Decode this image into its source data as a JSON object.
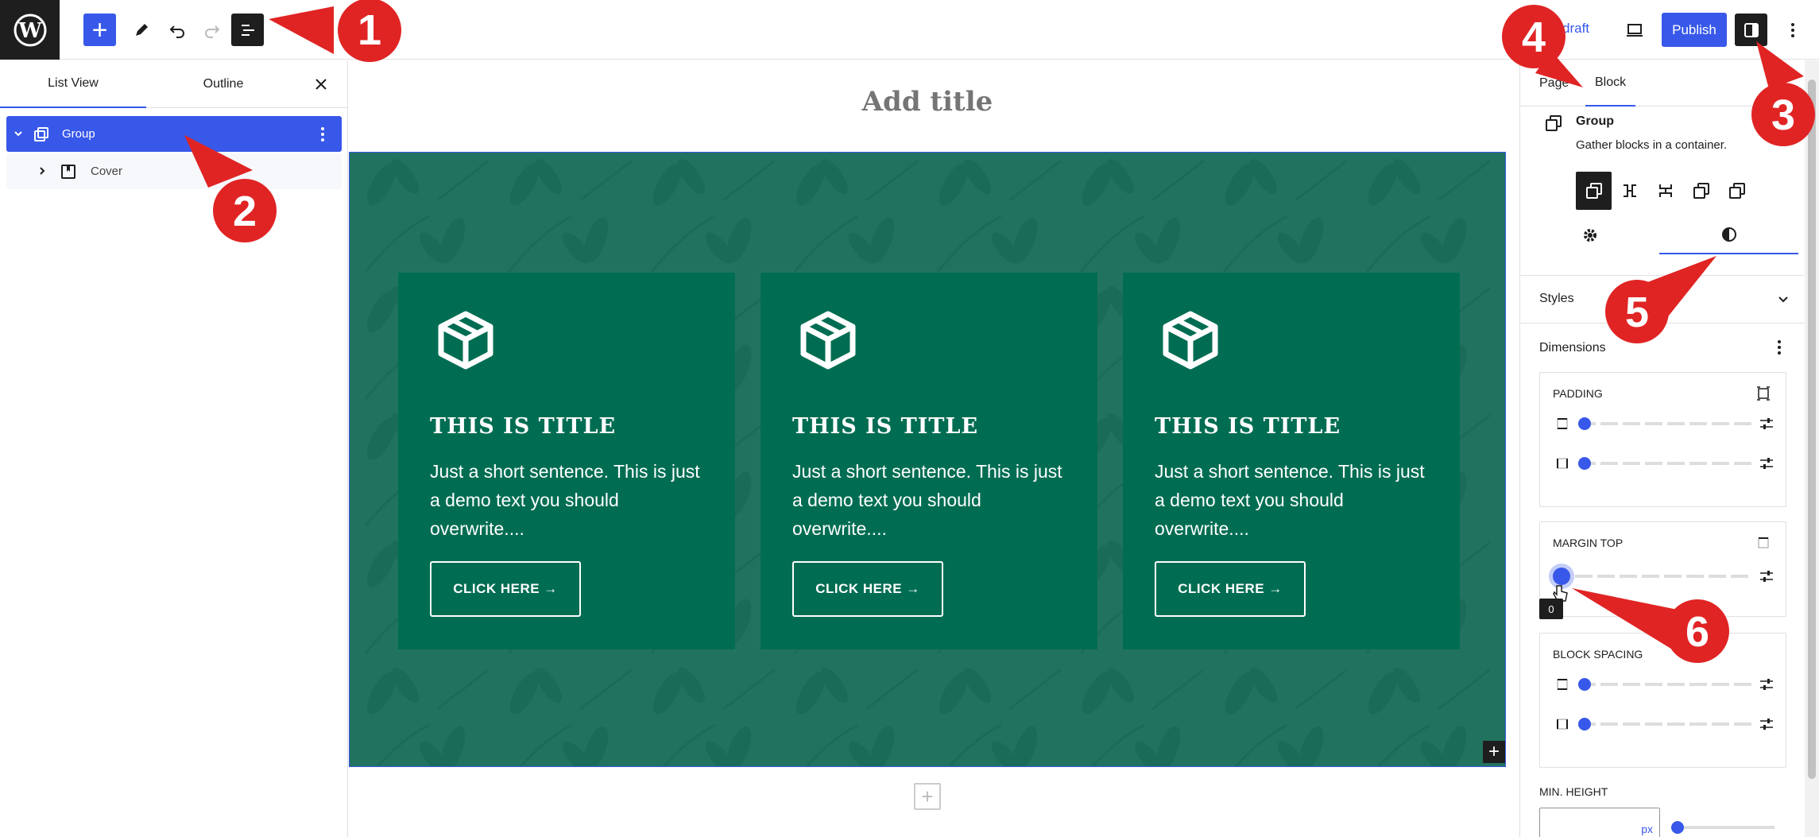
{
  "topbar": {
    "save_draft": "draft",
    "publish": "Publish"
  },
  "left_panel": {
    "tabs": [
      "List View",
      "Outline"
    ],
    "items": [
      {
        "label": "Group",
        "icon": "group-icon",
        "selected": true
      },
      {
        "label": "Cover",
        "icon": "cover-icon",
        "selected": false
      }
    ]
  },
  "canvas": {
    "title_placeholder": "Add title",
    "cards": [
      {
        "title": "THIS IS TITLE",
        "text": "Just a short sentence. This is just a demo text you should overwrite....",
        "button": "CLICK HERE →"
      },
      {
        "title": "THIS IS TITLE",
        "text": "Just a short sentence. This is just a demo text you should overwrite....",
        "button": "CLICK HERE →"
      },
      {
        "title": "THIS IS TITLE",
        "text": "Just a short sentence. This is just a demo text you should overwrite....",
        "button": "CLICK HERE →"
      }
    ],
    "cover_color": "#21735f",
    "card_color": "#006d52"
  },
  "sidebar": {
    "tabs": [
      "Page",
      "Block"
    ],
    "active_tab": "Block",
    "block_title": "Group",
    "block_desc": "Gather blocks in a container.",
    "sections": {
      "styles": "Styles",
      "dimensions": "Dimensions"
    },
    "padding": {
      "label": "PADDING",
      "values": [
        0,
        0
      ]
    },
    "margin_top": {
      "label": "MARGIN TOP",
      "value": 0,
      "tooltip": "0"
    },
    "block_spacing": {
      "label": "BLOCK SPACING",
      "values": [
        0,
        0
      ]
    },
    "min_height": {
      "label": "MIN. HEIGHT",
      "unit": "px"
    }
  },
  "annotations": [
    "1",
    "2",
    "3",
    "4",
    "5",
    "6"
  ],
  "colors": {
    "accent": "#3858e9",
    "annotation": "#e02424",
    "dark": "#1e1e1e"
  }
}
